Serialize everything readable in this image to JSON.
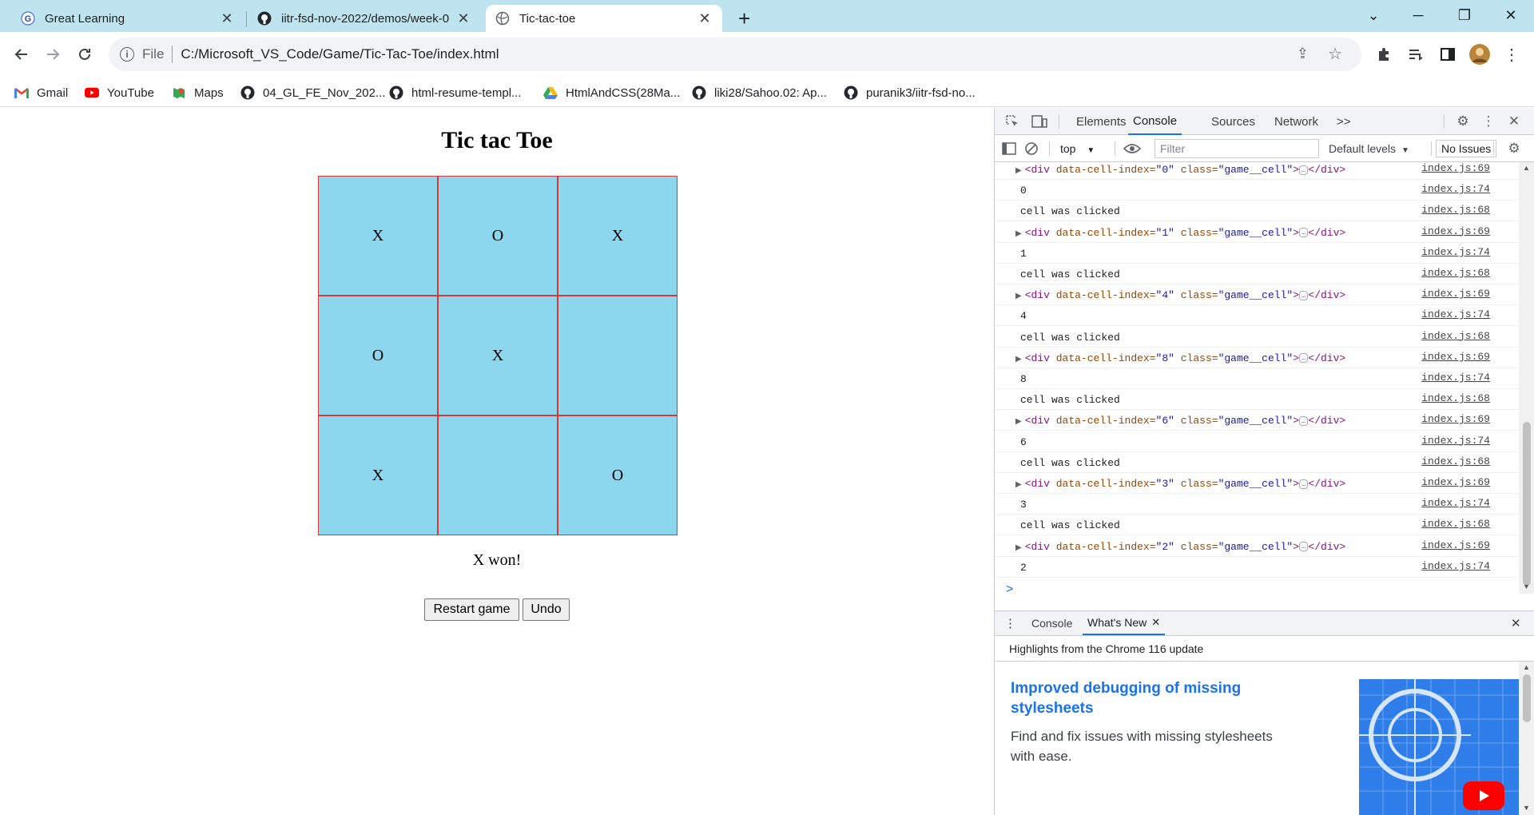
{
  "browser": {
    "tabs": [
      {
        "title": "Great Learning",
        "favicon": "great-learning-icon"
      },
      {
        "title": "iitr-fsd-nov-2022/demos/week-0",
        "favicon": "github-icon"
      },
      {
        "title": "Tic-tac-toe",
        "favicon": "globe-icon"
      }
    ],
    "new_tab_glyph": "+",
    "address": {
      "scheme_label": "File",
      "url": "C:/Microsoft_VS_Code/Game/Tic-Tac-Toe/index.html"
    },
    "bookmarks": [
      {
        "label": "Gmail",
        "icon": "gmail-icon"
      },
      {
        "label": "YouTube",
        "icon": "youtube-icon"
      },
      {
        "label": "Maps",
        "icon": "maps-icon"
      },
      {
        "label": "04_GL_FE_Nov_202...",
        "icon": "github-icon"
      },
      {
        "label": "html-resume-templ...",
        "icon": "github-icon"
      },
      {
        "label": "HtmlAndCSS(28Ma...",
        "icon": "google-drive-icon"
      },
      {
        "label": "liki28/Sahoo.02: Ap...",
        "icon": "github-icon"
      },
      {
        "label": "puranik3/iitr-fsd-no...",
        "icon": "github-icon"
      }
    ]
  },
  "game": {
    "title": "Tic tac Toe",
    "cells": [
      "X",
      "O",
      "X",
      "O",
      "X",
      "",
      "X",
      "",
      "O"
    ],
    "status": "X won!",
    "restart_label": "Restart game",
    "undo_label": "Undo",
    "colors": {
      "cell_bg": "#8dd7ee",
      "cell_border": "#d23a3a"
    }
  },
  "devtools": {
    "tabs": [
      "Elements",
      "Console",
      "Sources",
      "Network"
    ],
    "active_tab": "Console",
    "more_tabs_glyph": ">>",
    "context": "top",
    "filter_placeholder": "Filter",
    "levels": "Default levels",
    "issues": "No Issues",
    "log": [
      {
        "kind": "element",
        "idx": "0",
        "src": "index.js:69"
      },
      {
        "kind": "text",
        "msg": "0",
        "src": "index.js:74"
      },
      {
        "kind": "text",
        "msg": "cell was clicked",
        "src": "index.js:68"
      },
      {
        "kind": "element",
        "idx": "1",
        "src": "index.js:69"
      },
      {
        "kind": "text",
        "msg": "1",
        "src": "index.js:74"
      },
      {
        "kind": "text",
        "msg": "cell was clicked",
        "src": "index.js:68"
      },
      {
        "kind": "element",
        "idx": "4",
        "src": "index.js:69"
      },
      {
        "kind": "text",
        "msg": "4",
        "src": "index.js:74"
      },
      {
        "kind": "text",
        "msg": "cell was clicked",
        "src": "index.js:68"
      },
      {
        "kind": "element",
        "idx": "8",
        "src": "index.js:69"
      },
      {
        "kind": "text",
        "msg": "8",
        "src": "index.js:74"
      },
      {
        "kind": "text",
        "msg": "cell was clicked",
        "src": "index.js:68"
      },
      {
        "kind": "element",
        "idx": "6",
        "src": "index.js:69"
      },
      {
        "kind": "text",
        "msg": "6",
        "src": "index.js:74"
      },
      {
        "kind": "text",
        "msg": "cell was clicked",
        "src": "index.js:68"
      },
      {
        "kind": "element",
        "idx": "3",
        "src": "index.js:69"
      },
      {
        "kind": "text",
        "msg": "3",
        "src": "index.js:74"
      },
      {
        "kind": "text",
        "msg": "cell was clicked",
        "src": "index.js:68"
      },
      {
        "kind": "element",
        "idx": "2",
        "src": "index.js:69"
      },
      {
        "kind": "text",
        "msg": "2",
        "src": "index.js:74"
      }
    ],
    "element_parts": {
      "open": "<div",
      "attr1": "data-cell-index=",
      "attr2": "class=",
      "class_val": "\"game__cell\"",
      "close": "></div>"
    },
    "prompt_glyph": ">",
    "drawer": {
      "tabs": [
        "Console",
        "What's New"
      ],
      "active_tab": "What's New",
      "subtitle": "Highlights from the Chrome 116 update",
      "heading": "Improved debugging of missing stylesheets",
      "body": "Find and fix issues with missing stylesheets with ease."
    }
  }
}
